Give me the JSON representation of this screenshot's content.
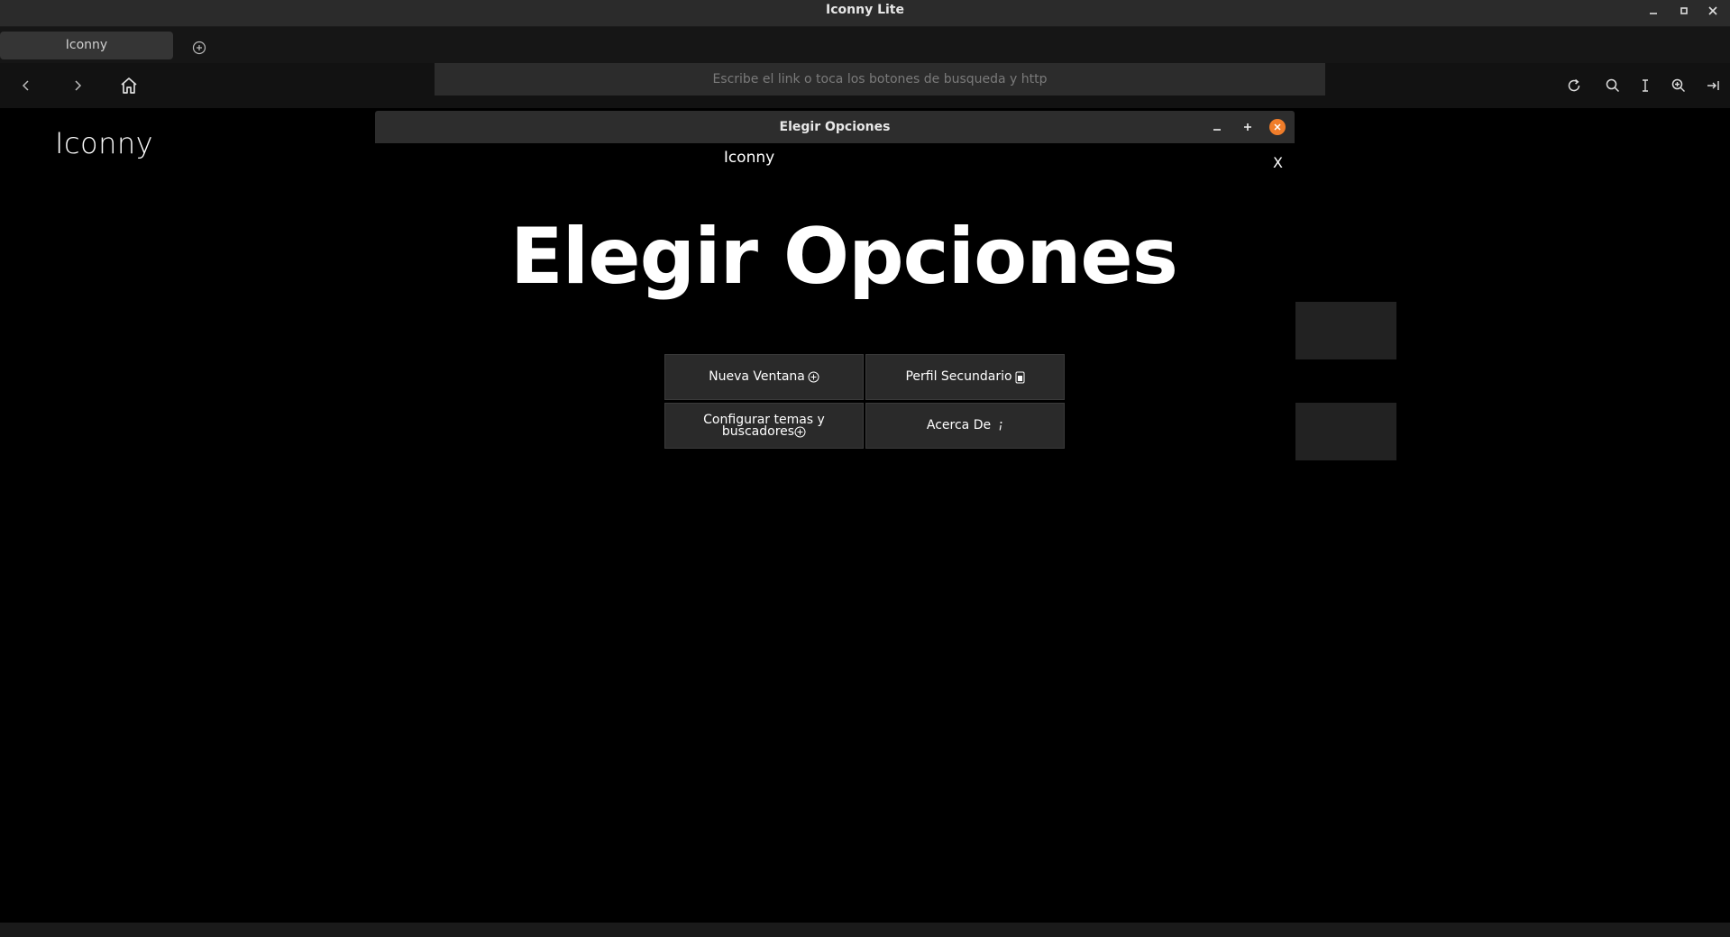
{
  "window": {
    "title": "Iconny Lite"
  },
  "tabs": [
    {
      "label": "Iconny"
    }
  ],
  "toolbar": {
    "url_placeholder": "Escribe el link o toca los botones de busqueda y http"
  },
  "page": {
    "logo_text": "Iconny"
  },
  "dialog": {
    "title": "Elegir Opciones",
    "app_name": "Iconny",
    "close_text": "X",
    "heading": "Elegir Opciones",
    "options": {
      "new_window": "Nueva Ventana",
      "secondary_profile": "Perfil Secundario",
      "configure_line1": "Configurar temas y",
      "configure_line2": "buscadores",
      "about": "Acerca De"
    }
  },
  "colors": {
    "background": "#000000",
    "titlebar": "#2b2b2b",
    "dialog_close": "#f07d2a",
    "button": "#2a2a2a"
  }
}
